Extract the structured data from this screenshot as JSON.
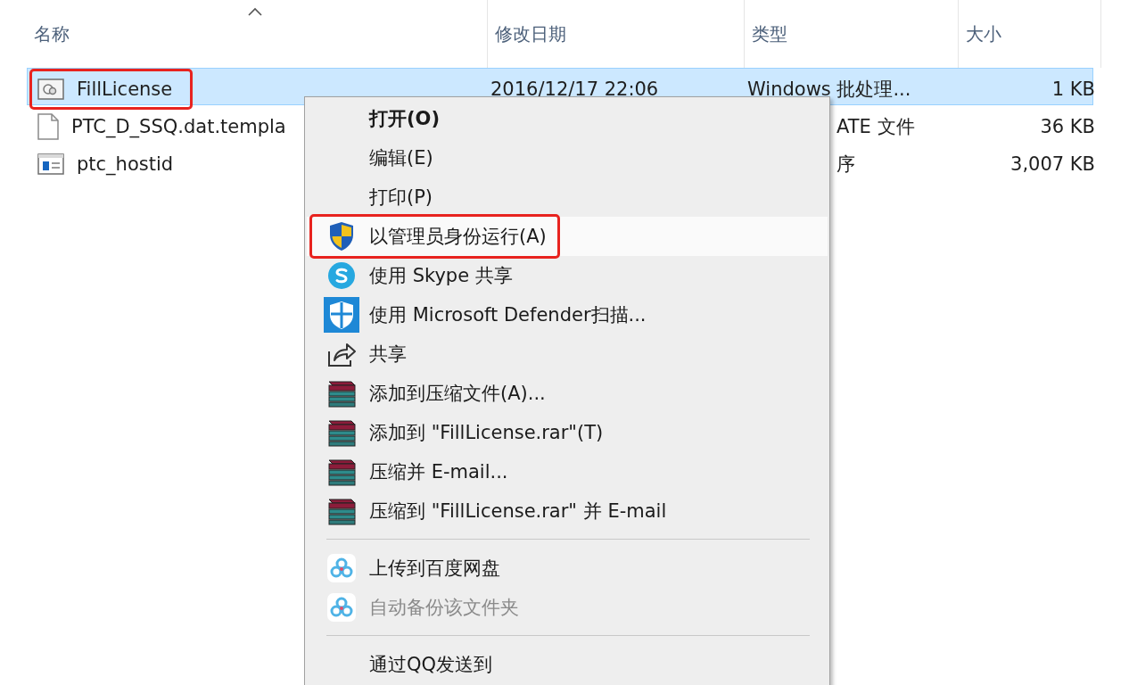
{
  "columns": [
    {
      "label": "名称",
      "sorted": true
    },
    {
      "label": "修改日期",
      "sorted": false
    },
    {
      "label": "类型",
      "sorted": false
    },
    {
      "label": "大小",
      "sorted": false
    }
  ],
  "files": [
    {
      "kind": "batch",
      "name": "FillLicense",
      "date": "2016/12/17 22:06",
      "type": "Windows 批处理...",
      "size": "1 KB",
      "selected": true,
      "highlighted": true
    },
    {
      "kind": "document",
      "name": "PTC_D_SSQ.dat.templa",
      "type": "ATE 文件",
      "size": "36 KB",
      "selected": false,
      "highlighted": false
    },
    {
      "kind": "application",
      "name": "ptc_hostid",
      "type": "序",
      "size": "3,007 KB",
      "selected": false,
      "highlighted": false
    }
  ],
  "context_menu": {
    "items": [
      {
        "kind": "plain",
        "label": "打开(O)",
        "bold": true,
        "disabled": false,
        "hovered": false,
        "highlighted": false
      },
      {
        "kind": "plain",
        "label": "编辑(E)",
        "bold": false,
        "disabled": false,
        "hovered": false,
        "highlighted": false
      },
      {
        "kind": "plain",
        "label": "打印(P)",
        "bold": false,
        "disabled": false,
        "hovered": false,
        "highlighted": false
      },
      {
        "kind": "shield",
        "label": "以管理员身份运行(A)",
        "bold": false,
        "disabled": false,
        "hovered": true,
        "highlighted": true
      },
      {
        "kind": "skype",
        "label": "使用 Skype 共享",
        "bold": false,
        "disabled": false,
        "hovered": false,
        "highlighted": false
      },
      {
        "kind": "defender",
        "label": "使用 Microsoft Defender扫描...",
        "bold": false,
        "disabled": false,
        "hovered": false,
        "highlighted": false
      },
      {
        "kind": "share",
        "label": "共享",
        "bold": false,
        "disabled": false,
        "hovered": false,
        "highlighted": false
      },
      {
        "kind": "archive",
        "label": "添加到压缩文件(A)...",
        "bold": false,
        "disabled": false,
        "hovered": false,
        "highlighted": false
      },
      {
        "kind": "archive",
        "label": "添加到 \"FillLicense.rar\"(T)",
        "bold": false,
        "disabled": false,
        "hovered": false,
        "highlighted": false
      },
      {
        "kind": "archive",
        "label": "压缩并 E-mail...",
        "bold": false,
        "disabled": false,
        "hovered": false,
        "highlighted": false
      },
      {
        "kind": "archive",
        "label": "压缩到 \"FillLicense.rar\" 并 E-mail",
        "bold": false,
        "disabled": false,
        "hovered": false,
        "highlighted": false
      },
      {
        "kind": "separator"
      },
      {
        "kind": "cloud",
        "label": "上传到百度网盘",
        "bold": false,
        "disabled": false,
        "hovered": false,
        "highlighted": false
      },
      {
        "kind": "cloud",
        "label": "自动备份该文件夹",
        "bold": false,
        "disabled": true,
        "hovered": false,
        "highlighted": false
      },
      {
        "kind": "separator"
      },
      {
        "kind": "plain",
        "label": "通过QQ发送到",
        "bold": false,
        "disabled": false,
        "hovered": false,
        "highlighted": false
      }
    ]
  }
}
